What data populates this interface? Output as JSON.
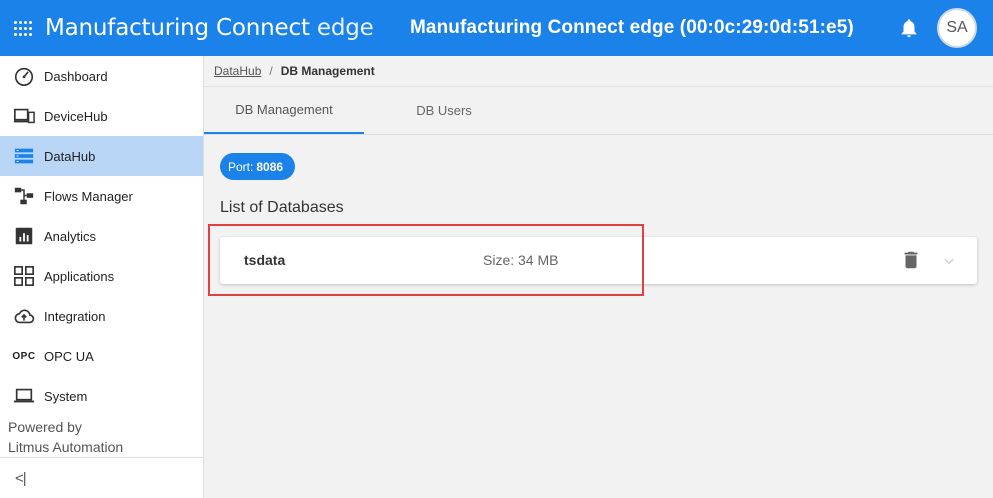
{
  "header": {
    "app_name": "Manufacturing Connect",
    "app_suffix": "edge",
    "device_title": "Manufacturing Connect edge (00:0c:29:0d:51:e5)",
    "avatar_initials": "SA",
    "icons": [
      "apps-grid-icon",
      "bell-icon"
    ]
  },
  "sidebar": {
    "items": [
      {
        "label": "Dashboard",
        "icon": "speedometer-icon",
        "active": false
      },
      {
        "label": "DeviceHub",
        "icon": "devices-icon",
        "active": false
      },
      {
        "label": "DataHub",
        "icon": "database-icon",
        "active": true
      },
      {
        "label": "Flows Manager",
        "icon": "flows-icon",
        "active": false
      },
      {
        "label": "Analytics",
        "icon": "analytics-icon",
        "active": false
      },
      {
        "label": "Applications",
        "icon": "applications-icon",
        "active": false
      },
      {
        "label": "Integration",
        "icon": "cloud-upload-icon",
        "active": false
      },
      {
        "label": "OPC UA",
        "icon_text": "OPC",
        "active": false
      },
      {
        "label": "System",
        "icon": "laptop-icon",
        "active": false
      }
    ],
    "powered_by_line1": "Powered by",
    "powered_by_line2": "Litmus Automation",
    "collapse_label": "<|"
  },
  "breadcrumb": {
    "parent": "DataHub",
    "separator": "/",
    "current": "DB Management"
  },
  "tabs": [
    {
      "label": "DB Management",
      "active": true
    },
    {
      "label": "DB Users",
      "active": false
    }
  ],
  "port": {
    "label": "Port:",
    "value": "8086"
  },
  "databases": {
    "title": "List of Databases",
    "items": [
      {
        "name": "tsdata",
        "size": "Size: 34 MB"
      }
    ]
  },
  "colors": {
    "primary": "#1a82e8",
    "active_nav": "#b9d6f7",
    "highlight": "#e04040"
  }
}
